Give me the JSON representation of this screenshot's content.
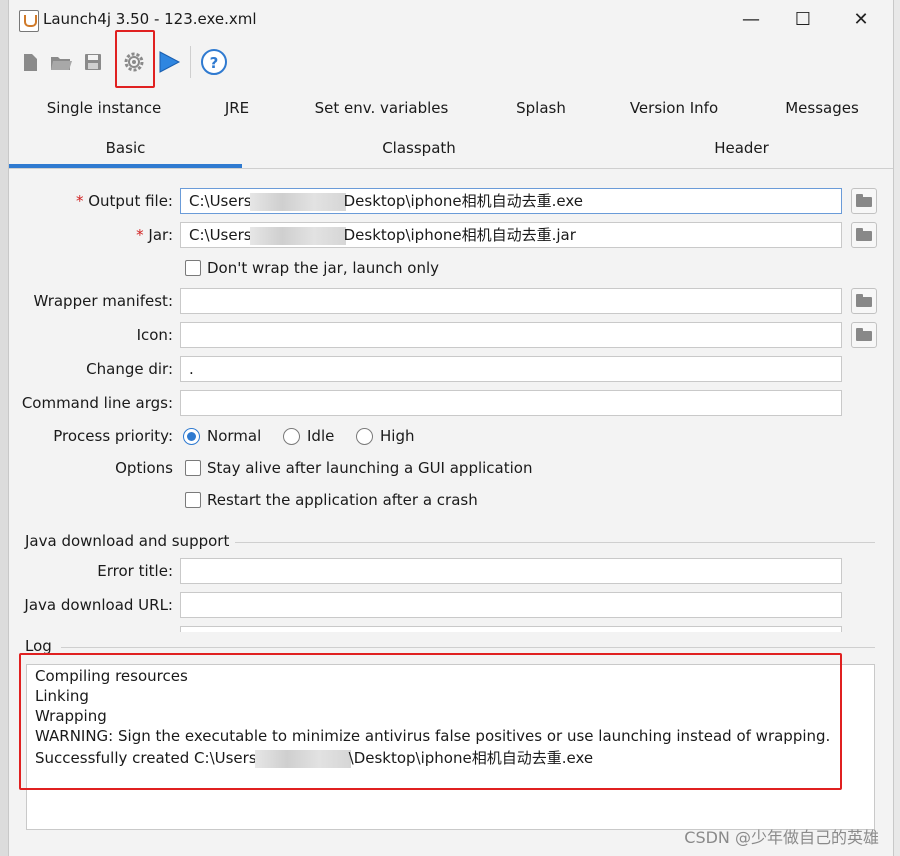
{
  "window": {
    "title": "Launch4j 3.50 - 123.exe.xml",
    "minimize": "—",
    "maximize": "☐",
    "close": "✕"
  },
  "toolbar": {
    "icons": [
      "new-icon",
      "open-icon",
      "save-icon",
      "settings-icon",
      "run-icon",
      "help-icon"
    ],
    "help_glyph": "?"
  },
  "tabs_top": [
    "Single instance",
    "JRE",
    "Set env. variables",
    "Splash",
    "Version Info",
    "Messages"
  ],
  "tabs_bottom": [
    "Basic",
    "Classpath",
    "Header"
  ],
  "basic": {
    "output_file_label": "Output file:",
    "output_file_prefix": "C:\\Users",
    "output_file_suffix": "Desktop\\iphone相机自动去重.exe",
    "jar_label": "Jar:",
    "jar_prefix": "C:\\Users",
    "jar_suffix": "Desktop\\iphone相机自动去重.jar",
    "dont_wrap_label": "Don't wrap the jar, launch only",
    "wrapper_manifest_label": "Wrapper manifest:",
    "icon_label": "Icon:",
    "change_dir_label": "Change dir:",
    "change_dir_value": ".",
    "cmd_args_label": "Command line args:",
    "priority_label": "Process priority:",
    "priority_options": [
      "Normal",
      "Idle",
      "High"
    ],
    "priority_selected": "Normal",
    "options_label": "Options",
    "stay_alive_label": "Stay alive after launching a GUI application",
    "restart_label": "Restart the application after a crash",
    "java_group_label": "Java download and support",
    "error_title_label": "Error title:",
    "java_url_label": "Java download URL:"
  },
  "log": {
    "label": "Log",
    "lines": [
      "Compiling resources",
      "Linking",
      "Wrapping",
      "WARNING: Sign the executable to minimize antivirus false positives or use launching instead of wrapping.",
      "Successfully created C:\\Users"
    ],
    "last_line_suffix": "\\Desktop\\iphone相机自动去重.exe"
  },
  "watermark": "CSDN @少年做自己的英雄",
  "colors": {
    "accent": "#2f7ad0",
    "highlight": "#e02020",
    "required": "#d02020"
  }
}
